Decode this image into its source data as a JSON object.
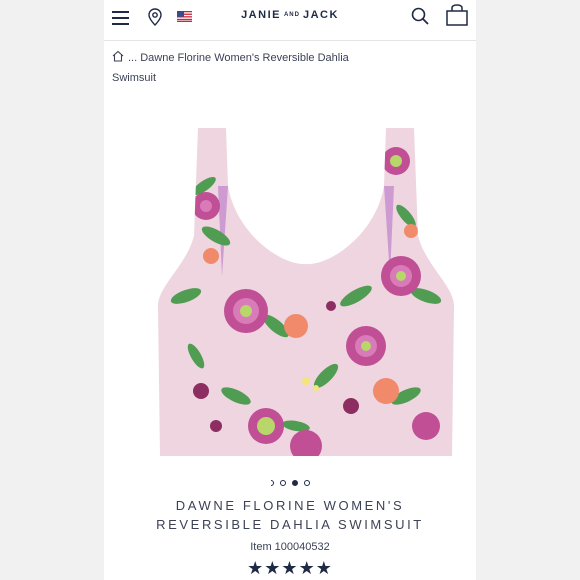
{
  "header": {
    "brand_main_1": "JANIE",
    "brand_small": "AND",
    "brand_main_2": "JACK",
    "menu_icon": "hamburger-icon",
    "location_icon": "map-pin-icon",
    "flag_icon": "us-flag-icon",
    "search_icon": "search-icon",
    "bag_icon": "shopping-bag-icon"
  },
  "breadcrumb": {
    "home_icon": "home-icon",
    "text": "... Dawne Florine Women's Reversible Dahlia Swimsuit"
  },
  "product": {
    "title": "Dawne Florine Women's Reversible Dahlia Swimsuit",
    "item_number": "Item 100040532",
    "rating": 5,
    "stars": "★★★★★",
    "carousel": {
      "count": 3,
      "active_index": 1
    }
  },
  "colors": {
    "navy": "#1f2a44",
    "swimsuit_base": "#eed5df",
    "flower_pink": "#c04f96",
    "leaf_green": "#4f9c52",
    "flower_coral": "#f08a6a"
  }
}
